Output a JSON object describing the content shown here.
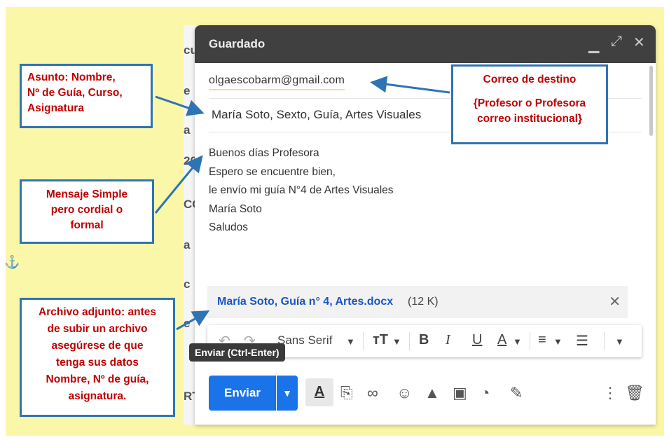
{
  "window": {
    "title": "Guardado",
    "controls": [
      "minimize-icon",
      "expand-icon",
      "close-icon"
    ]
  },
  "email": {
    "to": "olgaescobarm@gmail.com",
    "subject": "María Soto, Sexto, Guía, Artes Visuales",
    "body_lines": [
      "Buenos días Profesora",
      "Espero se encuentre bien,",
      "le envío mi guía N°4 de Artes Visuales",
      "María Soto",
      "Saludos"
    ],
    "attachment": {
      "name": "María Soto, Guía n° 4, Artes.docx",
      "size": "(12 K)"
    }
  },
  "format_bar": {
    "font": "Sans Serif",
    "icons": [
      "undo-icon",
      "redo-icon",
      "font-size-icon",
      "bold-icon",
      "italic-icon",
      "underline-icon",
      "text-color-icon",
      "align-icon",
      "list-icon",
      "more-options-icon"
    ]
  },
  "tooltip": "Enviar (Ctrl-Enter)",
  "send": {
    "label": "Enviar",
    "icons": [
      "formatting-icon",
      "attach-icon",
      "link-icon",
      "emoji-icon",
      "drive-icon",
      "photo-icon",
      "confidential-icon",
      "signature-icon",
      "more-vert-icon",
      "trash-icon"
    ]
  },
  "annotations": {
    "subject": [
      "Asunto: Nombre,",
      "Nº de Guía, Curso,",
      "Asignatura"
    ],
    "message": [
      "Mensaje Simple",
      "pero cordial o",
      "formal"
    ],
    "attachment": [
      "Archivo adjunto: antes",
      "de subir un archivo",
      "asegúrese de que",
      "tenga sus datos",
      "Nombre, Nº de guía,",
      "asignatura."
    ],
    "destination_title": "Correo de destino",
    "destination_detail": [
      "{Profesor o Profesora",
      "correo institucional}"
    ]
  },
  "colors": {
    "slide_background": "#fbf7a8",
    "annotation_border": "#2e74b5",
    "annotation_text": "#c00000",
    "send_button": "#1a73e8",
    "titlebar": "#404040",
    "attachment_link": "#1a56c5"
  }
}
